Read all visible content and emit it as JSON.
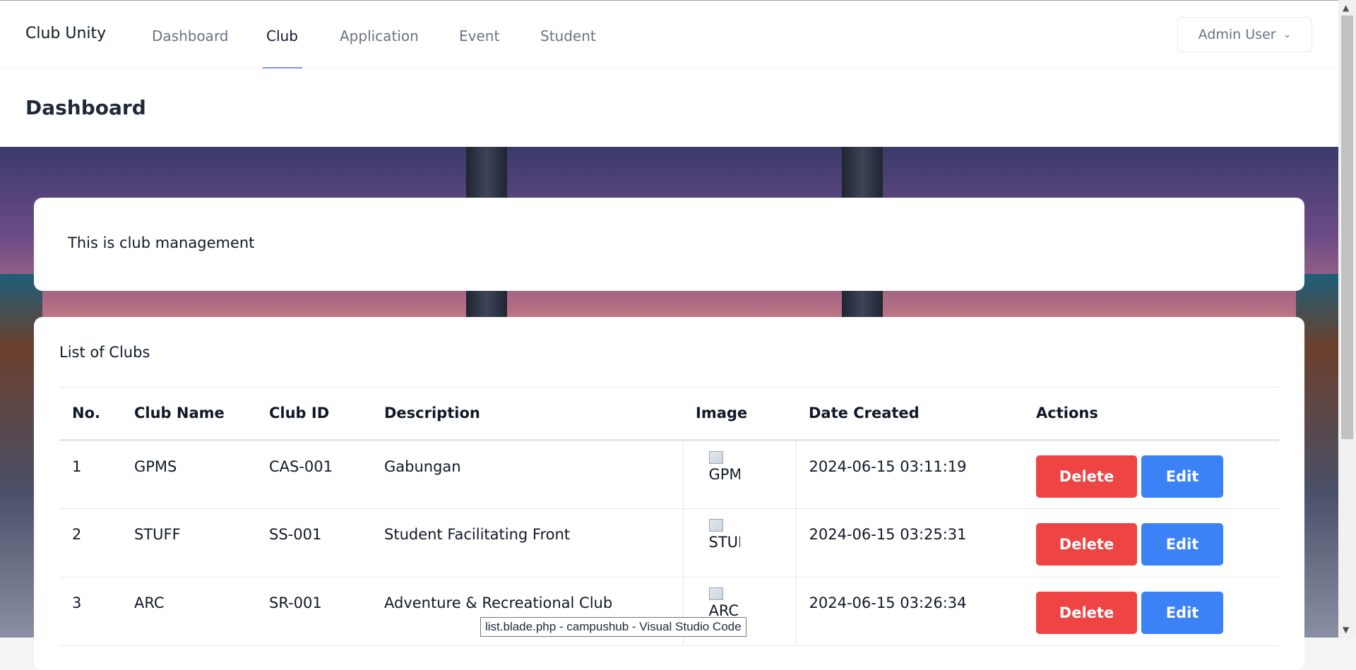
{
  "nav": {
    "brand": "Club Unity",
    "links": [
      {
        "label": "Dashboard"
      },
      {
        "label": "Club"
      },
      {
        "label": "Application"
      },
      {
        "label": "Event"
      },
      {
        "label": "Student"
      }
    ],
    "user": "Admin User"
  },
  "header": {
    "title": "Dashboard"
  },
  "intro": {
    "text": "This is club management"
  },
  "list": {
    "title": "List of Clubs",
    "columns": [
      "No.",
      "Club Name",
      "Club ID",
      "Description",
      "Image",
      "Date Created",
      "Actions"
    ],
    "rows": [
      {
        "no": "1",
        "name": "GPMS",
        "id": "CAS-001",
        "description": "Gabungan",
        "image_alt": "GPMS",
        "date": "2024-06-15 03:11:19"
      },
      {
        "no": "2",
        "name": "STUFF",
        "id": "SS-001",
        "description": "Student Facilitating Front",
        "image_alt": "STUFF",
        "date": "2024-06-15 03:25:31"
      },
      {
        "no": "3",
        "name": "ARC",
        "id": "SR-001",
        "description": "Adventure & Recreational Club",
        "image_alt": "ARC",
        "date": "2024-06-15 03:26:34"
      }
    ],
    "delete_label": "Delete",
    "edit_label": "Edit"
  },
  "tooltip": "list.blade.php - campushub - Visual Studio Code",
  "colors": {
    "delete": "#ef4444",
    "edit": "#3b82f6",
    "active_underline": "#818cf8"
  }
}
